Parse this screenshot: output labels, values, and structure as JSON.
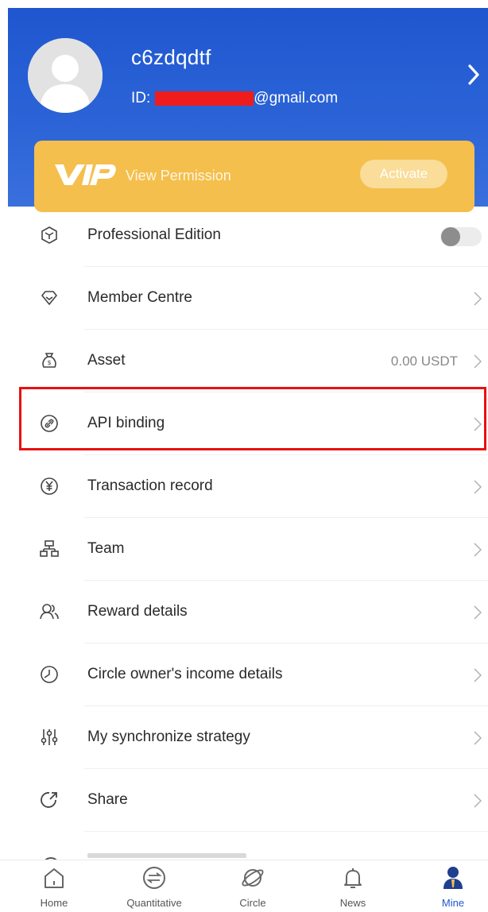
{
  "user": {
    "username": "c6zdqdtf",
    "id_label": "ID:",
    "email_suffix": "@gmail.com"
  },
  "vip": {
    "logo_text": "VIP",
    "label": "View Permission",
    "button": "Activate"
  },
  "menu": [
    {
      "label": "Professional Edition",
      "icon": "cube-icon",
      "control": "toggle",
      "toggle_on": false
    },
    {
      "label": "Member Centre",
      "icon": "diamond-icon"
    },
    {
      "label": "Asset",
      "icon": "money-bag-icon",
      "value": "0.00 USDT"
    },
    {
      "label": "API binding",
      "icon": "link-icon",
      "highlighted": true
    },
    {
      "label": "Transaction record",
      "icon": "yen-icon"
    },
    {
      "label": "Team",
      "icon": "org-chart-icon"
    },
    {
      "label": "Reward details",
      "icon": "users-icon"
    },
    {
      "label": "Circle owner's income details",
      "icon": "clock-icon"
    },
    {
      "label": "My synchronize strategy",
      "icon": "sliders-icon"
    },
    {
      "label": "Share",
      "icon": "share-icon"
    }
  ],
  "tabs": [
    {
      "label": "Home",
      "icon": "home-icon"
    },
    {
      "label": "Quantitative",
      "icon": "exchange-icon"
    },
    {
      "label": "Circle",
      "icon": "planet-icon"
    },
    {
      "label": "News",
      "icon": "bell-icon"
    },
    {
      "label": "Mine",
      "icon": "person-icon",
      "active": true
    }
  ],
  "colors": {
    "header_blue": "#1f56cf",
    "vip_gold": "#f4bf4d",
    "highlight_red": "#e81010",
    "active_tab": "#1f56cf"
  }
}
